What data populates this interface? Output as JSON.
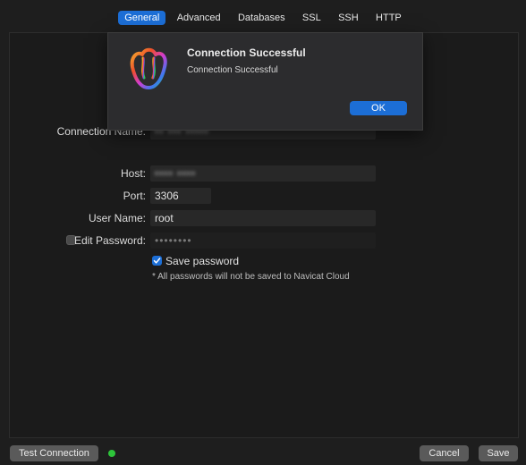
{
  "tabs": [
    "General",
    "Advanced",
    "Databases",
    "SSL",
    "SSH",
    "HTTP"
  ],
  "form": {
    "connection_name_label": "Connection Name:",
    "connection_name_value": "•• ••• •••••",
    "host_label": "Host:",
    "host_value": "•••• ••••",
    "port_label": "Port:",
    "port_value": "3306",
    "username_label": "User Name:",
    "username_value": "root",
    "edit_password_label": "Edit Password:",
    "password_value": "••••••••",
    "save_password_label": "Save password",
    "note": "* All passwords will not be saved to Navicat Cloud"
  },
  "dialog": {
    "title": "Connection Successful",
    "message": "Connection Successful",
    "ok_label": "OK"
  },
  "footer": {
    "test_connection_label": "Test Connection",
    "cancel_label": "Cancel",
    "save_label": "Save"
  },
  "colors": {
    "accent": "#1c6ed6",
    "status_ok": "#2dc43a"
  },
  "icons": {
    "dialog": "navicat-logo-icon",
    "check": "checkmark-icon"
  }
}
